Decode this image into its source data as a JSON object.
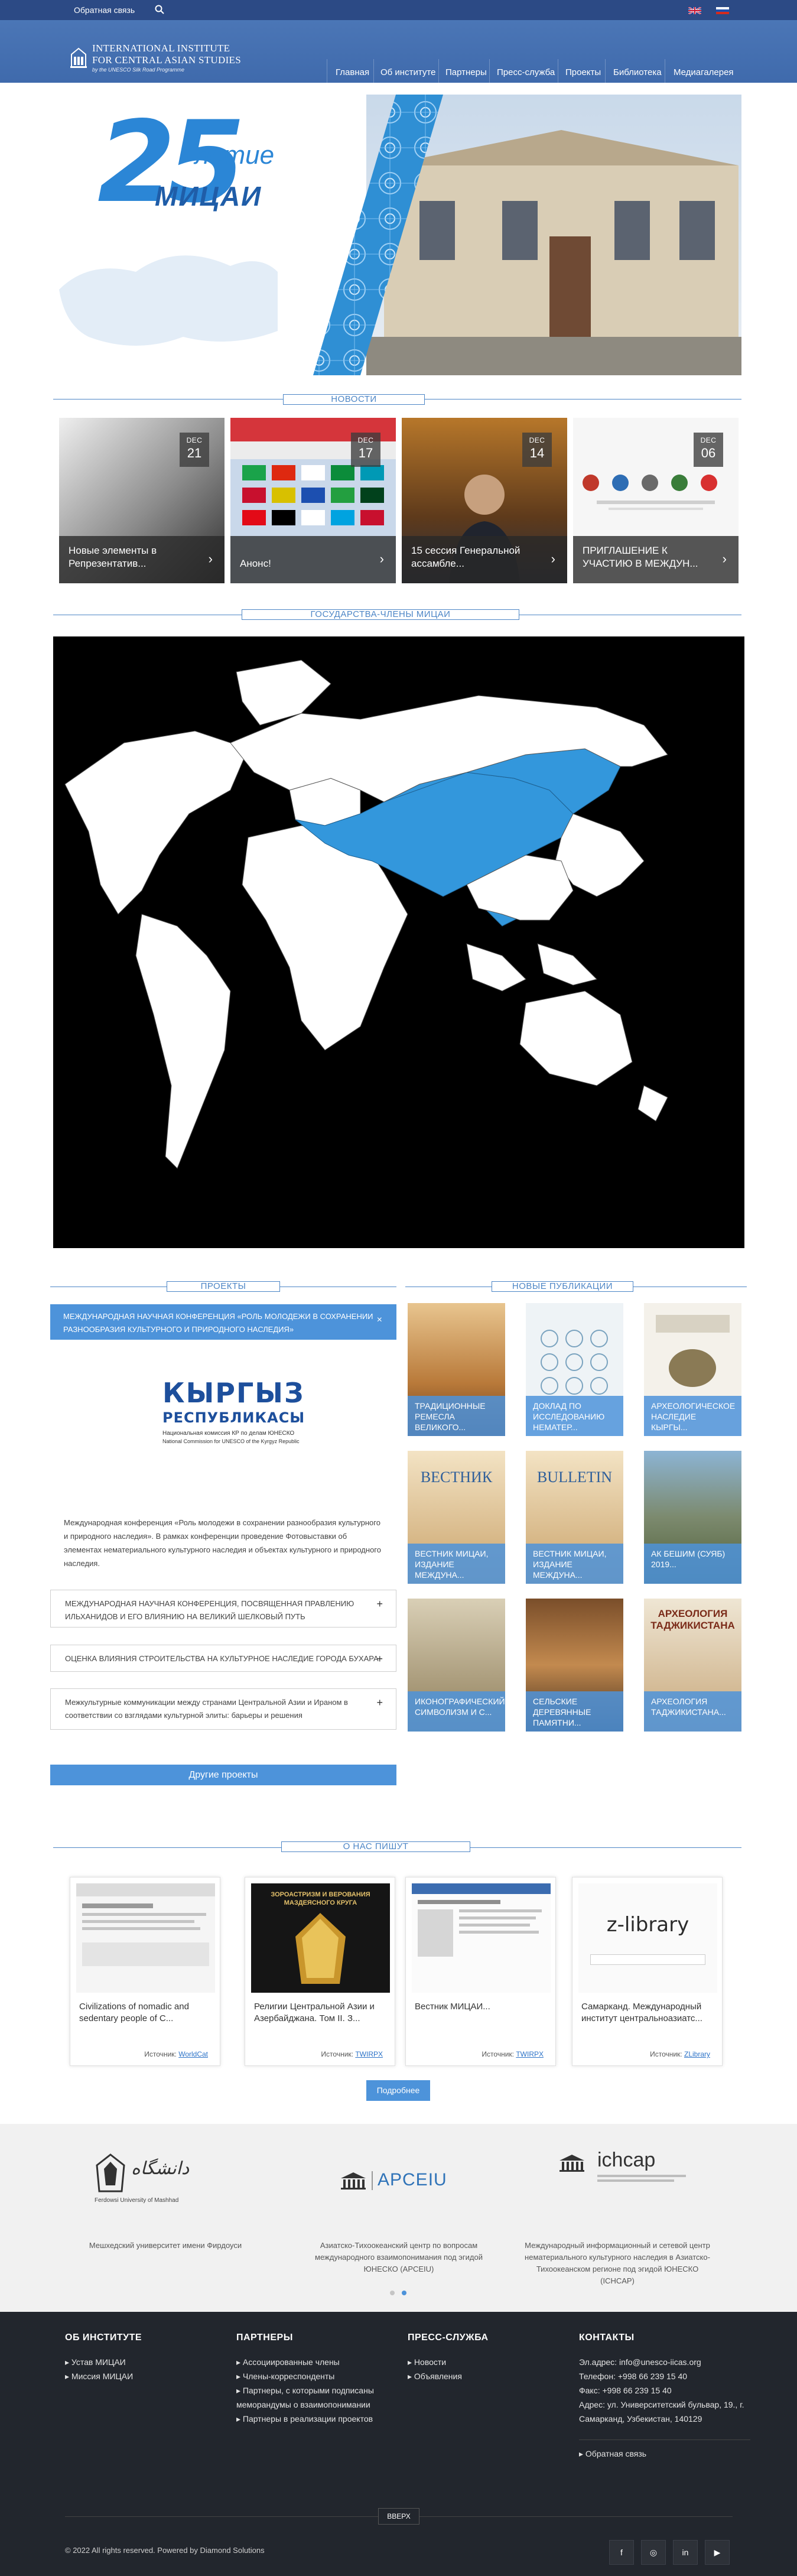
{
  "topbar": {
    "feedback": "Обратная связь",
    "search_icon": "search-icon",
    "flags": [
      "flag-uk-icon",
      "flag-ru-icon"
    ]
  },
  "logo": {
    "line1": "INTERNATIONAL INSTITUTE",
    "line2": "FOR CENTRAL ASIAN STUDIES",
    "line3": "by the UNESCO Silk Road Programme"
  },
  "nav": [
    "Главная",
    "Об институте",
    "Партнеры",
    "Пресс-служба",
    "Проекты",
    "Библиотека",
    "Медиагалерея"
  ],
  "hero": {
    "big": "25",
    "suffix": "-летие",
    "name": "МИЦАИ"
  },
  "sections": {
    "news": "НОВОСТИ",
    "members": "ГОСУДАРСТВА-ЧЛЕНЫ МИЦАИ",
    "projects": "ПРОЕКТЫ",
    "publications": "НОВЫЕ ПУБЛИКАЦИИ",
    "about": "О НАС ПИШУТ"
  },
  "news": [
    {
      "month": "DEC",
      "day": "21",
      "title": "Новые элементы в Репрезентатив..."
    },
    {
      "month": "DEC",
      "day": "17",
      "title": "Анонс!"
    },
    {
      "month": "DEC",
      "day": "14",
      "title": "15 сессия Генеральной ассамбле..."
    },
    {
      "month": "DEC",
      "day": "06",
      "title": "ПРИГЛАШЕНИЕ К УЧАСТИЮ В МЕЖДУН..."
    }
  ],
  "projects": {
    "active": "МЕЖДУНАРОДНАЯ НАУЧНАЯ КОНФЕРЕНЦИЯ «РОЛЬ МОЛОДЕЖИ В СОХРАНЕНИИ РАЗНООБРАЗИЯ КУЛЬТУРНОГО И ПРИРОДНОГО НАСЛЕДИЯ»",
    "kg_logo_big": "КЫРГЫЗ",
    "kg_logo_mid": "РЕСПУБЛИКАСЫ",
    "kg_logo_sub": "Национальная комиссия КР по делам ЮНЕСКО",
    "kg_logo_sub2": "National Commission for UNESCO of the Kyrgyz Republic",
    "description": "Международная конференция «Роль молодежи в сохранении разнообразия культурного и природного наследия». В рамках конференции проведение Фотовыставки об элементах нематериального культурного наследия и объектах культурного и природного наследия.",
    "items": [
      "МЕЖДУНАРОДНАЯ НАУЧНАЯ КОНФЕРЕНЦИЯ, ПОСВЯЩЕННАЯ ПРАВЛЕНИЮ ИЛЬХАНИДОВ И ЕГО ВЛИЯНИЮ НА ВЕЛИКИЙ ШЕЛКОВЫЙ ПУТЬ",
      "ОЦЕНКА ВЛИЯНИЯ СТРОИТЕЛЬСТВА НА КУЛЬТУРНОЕ НАСЛЕДИЕ ГОРОДА БУХАРА",
      "Межкультурные коммуникации между странами Центральной Азии и Ираном в соответствии со взглядами культурной элиты: барьеры и решения"
    ],
    "other_button": "Другие проекты"
  },
  "publications": [
    {
      "caption": "ТРАДИЦИОННЫЕ РЕМЕСЛА ВЕЛИКОГО..."
    },
    {
      "caption": "ДОКЛАД ПО ИССЛЕДОВАНИЮ НЕМАТЕР..."
    },
    {
      "caption": "АРХЕОЛОГИЧЕСКОЕ НАСЛЕДИЕ КЫРГЫ..."
    },
    {
      "caption": "ВЕСТНИК МИЦАИ, ИЗДАНИЕ МЕЖДУНА...",
      "cover": "ВЕСТНИК"
    },
    {
      "caption": "ВЕСТНИК МИЦАИ, ИЗДАНИЕ МЕЖДУНА...",
      "cover": "BULLETIN"
    },
    {
      "caption": "АК БЕШИМ (СУЯБ) 2019..."
    },
    {
      "caption": "ИКОНОГРАФИЧЕСКИЙ СИМВОЛИЗМ И С..."
    },
    {
      "caption": "СЕЛЬСКИЕ ДЕРЕВЯННЫЕ ПАМЯТНИ..."
    },
    {
      "caption": "АРХЕОЛОГИЯ ТАДЖИКИСТАНА...",
      "cover": "АРХЕОЛОГИЯ ТАДЖИКИСТАНА"
    }
  ],
  "about": [
    {
      "title": "Civilizations of nomadic and sedentary people of C...",
      "source_label": "Источник:",
      "source": "WorldCat"
    },
    {
      "title": "Религии Центральной Азии и Азербайджана. Том II. З...",
      "source_label": "Источник:",
      "source": "TWIRPX",
      "cover": "ЗОРОАСТРИЗМ И ВЕРОВАНИЯ МАЗДЕЯСНОГО КРУГА"
    },
    {
      "title": "Вестник МИЦАИ...",
      "source_label": "Источник:",
      "source": "TWIRPX"
    },
    {
      "title": "Самарканд. Международный институт центральноазиатс...",
      "source_label": "Источник:",
      "source": "ZLibrary",
      "logo": "z-library"
    }
  ],
  "more_button": "Подробнее",
  "partners": [
    {
      "name": "Мешхедский университет имени Фирдоуси",
      "logo_text": "Ferdowsi University of Mashhad"
    },
    {
      "name": "Азиатско-Тихоокеанский центр по вопросам международного взаимопонимания под эгидой ЮНЕСКО (APCEIU)",
      "logo_text": "APCEIU"
    },
    {
      "name": "Международный информационный и сетевой центр нематериального культурного наследия в Азиатско-Тихоокеанском регионе под эгидой ЮНЕСКО (ICHCAP)",
      "logo_text": "ichcap"
    }
  ],
  "footer": {
    "col1": {
      "title": "ОБ ИНСТИТУТЕ",
      "links": [
        "Устав МИЦАИ",
        "Миссия МИЦАИ"
      ]
    },
    "col2": {
      "title": "ПАРТНЕРЫ",
      "links": [
        "Ассоциированные члены",
        "Члены-корреспонденты",
        "Партнеры, с которыми подписаны меморандумы о взаимопонимании",
        "Партнеры в реализации проектов"
      ]
    },
    "col3": {
      "title": "ПРЕСС-СЛУЖБА",
      "links": [
        "Новости",
        "Объявления"
      ]
    },
    "col4": {
      "title": "КОНТАКТЫ",
      "lines": [
        "Эл.адрес: info@unesco-iicas.org",
        "Телефон: +998 66 239 15 40",
        "Факс: +998 66 239 15 40",
        "Адрес: ул. Университетский бульвар, 19., г. Самарканд, Узбекистан, 140129"
      ],
      "feedback": "Обратная связь"
    },
    "up": "ВВЕРХ",
    "copyright": "© 2022 All rights reserved. Powered by Diamond Solutions",
    "social": [
      "facebook-icon",
      "instagram-icon",
      "linkedin-icon",
      "youtube-icon"
    ]
  },
  "colors": {
    "primary": "#3f6aac",
    "accent": "#4d93da",
    "map_highlight": "#3397dc",
    "footer": "#22262d"
  }
}
